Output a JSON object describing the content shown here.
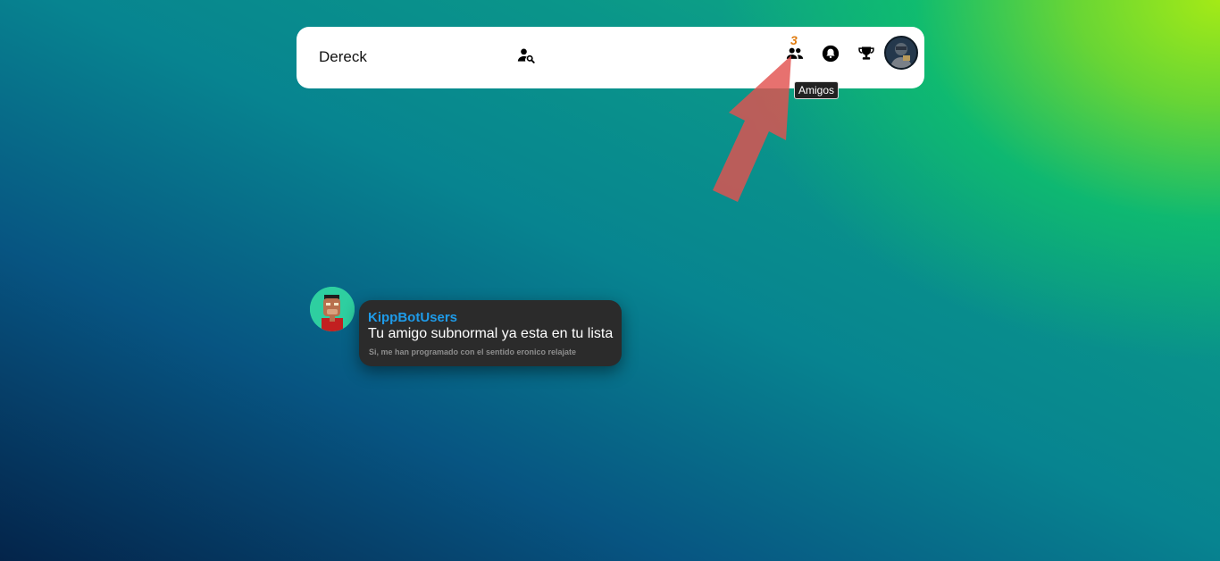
{
  "topbar": {
    "username": "Dereck",
    "friends_badge_count": "3",
    "friends_tooltip": "Amigos",
    "icons": {
      "search": "user-search-icon",
      "friends": "friends-icon",
      "notifications": "bell-icon",
      "achievements": "trophy-icon",
      "profile": "avatar"
    }
  },
  "notification": {
    "sender": "KippBotUsers",
    "message": "Tu amigo subnormal ya esta en tu lista",
    "subtext": "Si, me han programado con el sentido eronico relajate"
  },
  "colors": {
    "badge": "#e07c10",
    "sender": "#1e9be9",
    "arrow": "#e2524f",
    "toast_bg": "#2b2b2b"
  }
}
